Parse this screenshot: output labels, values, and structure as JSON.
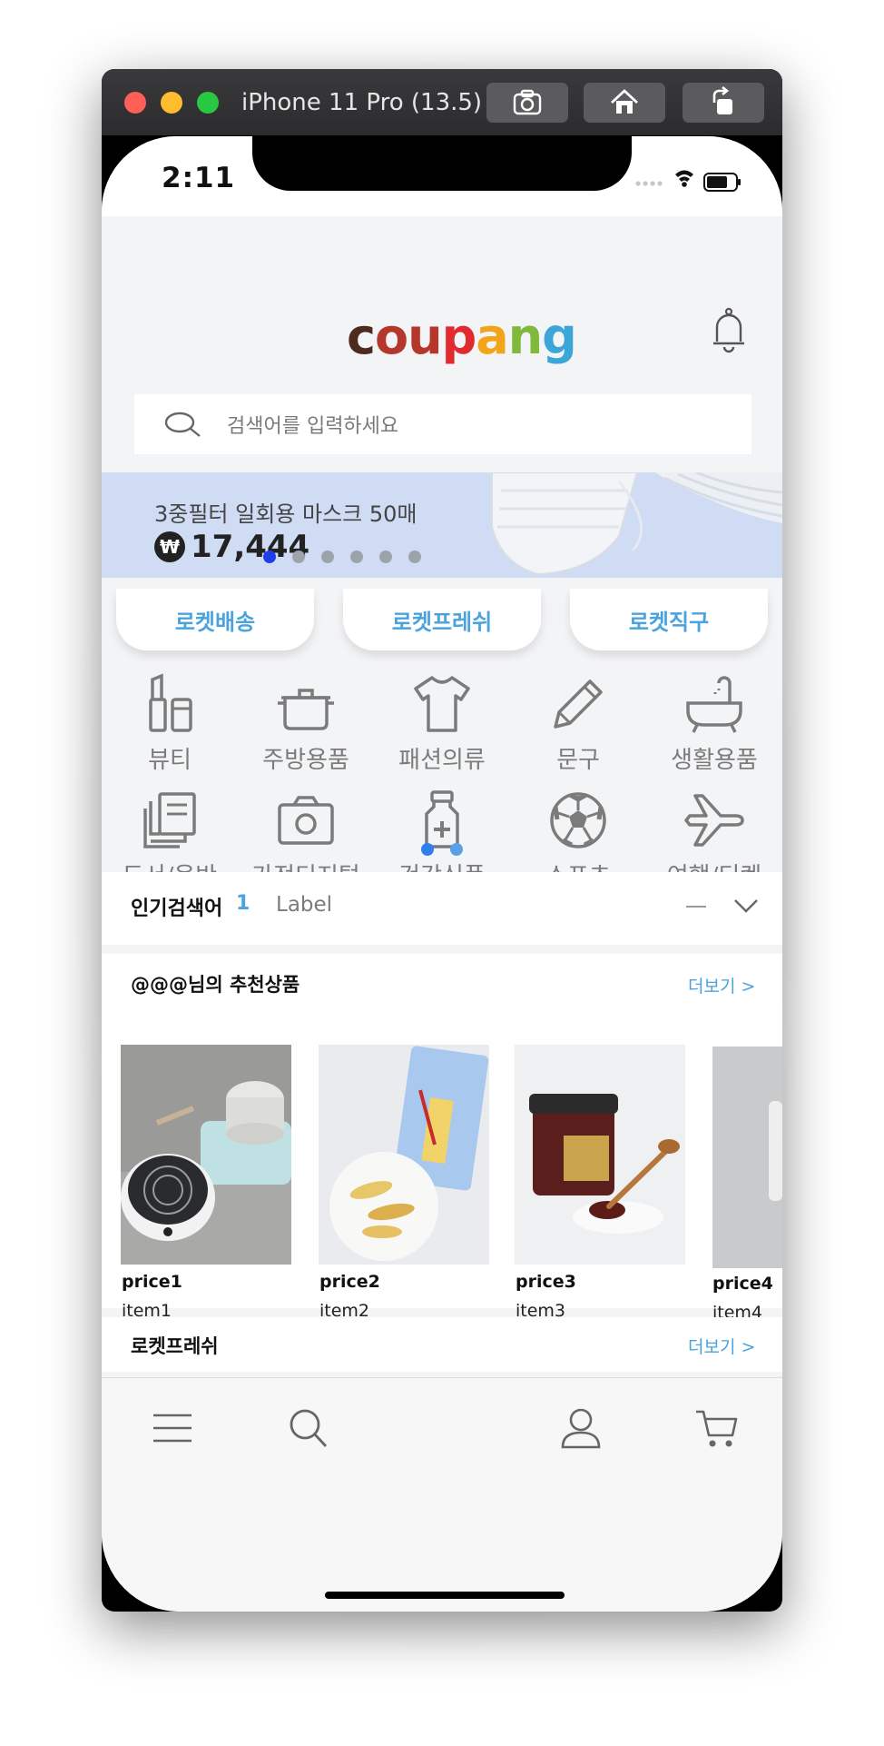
{
  "window": {
    "title": "iPhone 11 Pro (13.5)",
    "toolbar": [
      "screenshot-icon",
      "home-icon",
      "rotate-icon"
    ]
  },
  "status_bar": {
    "time": "2:11"
  },
  "header": {
    "logo_letters": [
      "c",
      "o",
      "u",
      "p",
      "a",
      "n",
      "g"
    ],
    "logo_colors": [
      "#4f2a1e",
      "#b5362a",
      "#e02a2e",
      "#f2a51a",
      "#80b93b",
      "#3ca6d9"
    ]
  },
  "search": {
    "placeholder": "검색어를 입력하세요"
  },
  "banner": {
    "title": "3중필터 일회용 마스크 50매",
    "currency": "₩",
    "price": "17,444",
    "slide_count": 6,
    "active_slide": 1
  },
  "shortcuts": [
    "로켓배송",
    "로켓프레쉬",
    "로켓직구"
  ],
  "categories": [
    {
      "label": "뷰티",
      "icon": "cosmetics-icon"
    },
    {
      "label": "주방용품",
      "icon": "pot-icon"
    },
    {
      "label": "패션의류",
      "icon": "tshirt-icon"
    },
    {
      "label": "문구",
      "icon": "pencil-icon"
    },
    {
      "label": "생활용품",
      "icon": "bathtub-icon"
    },
    {
      "label": "도서/음반",
      "icon": "book-icon"
    },
    {
      "label": "가전디지털",
      "icon": "camera-icon"
    },
    {
      "label": "건강식품",
      "icon": "medicine-bottle-icon"
    },
    {
      "label": "스포츠",
      "icon": "soccer-ball-icon"
    },
    {
      "label": "여행/티켓",
      "icon": "airplane-icon"
    }
  ],
  "popular": {
    "title": "인기검색어",
    "rank": "1",
    "keyword": "Label"
  },
  "recommend": {
    "title": "@@@님의 추천상품",
    "more": "더보기 >",
    "products": [
      {
        "price": "price1",
        "name": "item1"
      },
      {
        "price": "price2",
        "name": "item2"
      },
      {
        "price": "price3",
        "name": "item3"
      },
      {
        "price": "price4",
        "name": "item4"
      }
    ]
  },
  "fresh": {
    "title": "로켓프레쉬",
    "more": "더보기 >"
  },
  "tabbar": [
    "menu-icon",
    "search-icon",
    "profile-icon",
    "cart-icon"
  ],
  "colors": {
    "accent": "#4aa3dc",
    "banner_bg": "#cfdcf4",
    "active_dot": "#1f3fe8"
  }
}
